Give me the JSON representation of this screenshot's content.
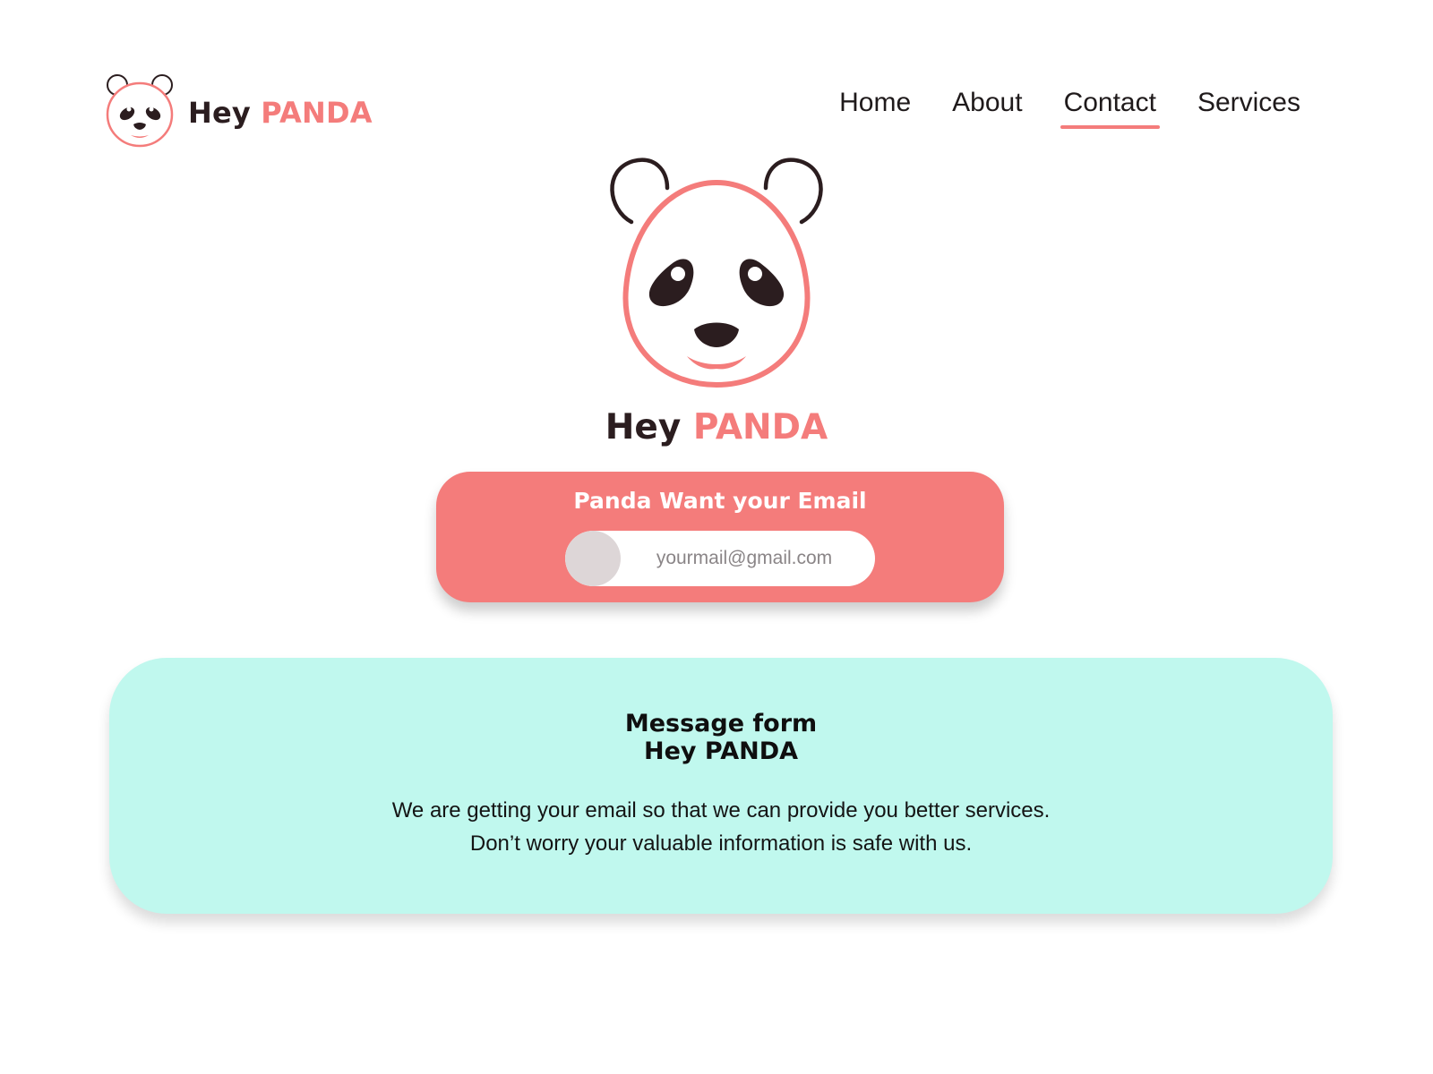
{
  "brand": {
    "name_part1": "Hey",
    "name_part2": "PANDA"
  },
  "nav": {
    "items": [
      {
        "label": "Home",
        "active": false
      },
      {
        "label": "About",
        "active": false
      },
      {
        "label": "Contact",
        "active": true
      },
      {
        "label": "Services",
        "active": false
      }
    ]
  },
  "hero": {
    "title_part1": "Hey",
    "title_part2": "PANDA"
  },
  "email_card": {
    "title": "Panda Want your Email",
    "input_placeholder": "yourmail@gmail.com",
    "input_value": ""
  },
  "message_card": {
    "title_line1": "Message form",
    "title_line2": "Hey PANDA",
    "body_line1": "We are getting your email so that we can provide you better services.",
    "body_line2": "Don’t worry your valuable information is safe with us."
  },
  "colors": {
    "accent": "#f47c7b",
    "dark": "#2b1d1f",
    "mint": "#c0f8ee",
    "background": "#ffffff"
  },
  "icons": {
    "logo": "panda-head-icon",
    "hero": "panda-head-icon",
    "email_knob": "toggle-knob"
  }
}
